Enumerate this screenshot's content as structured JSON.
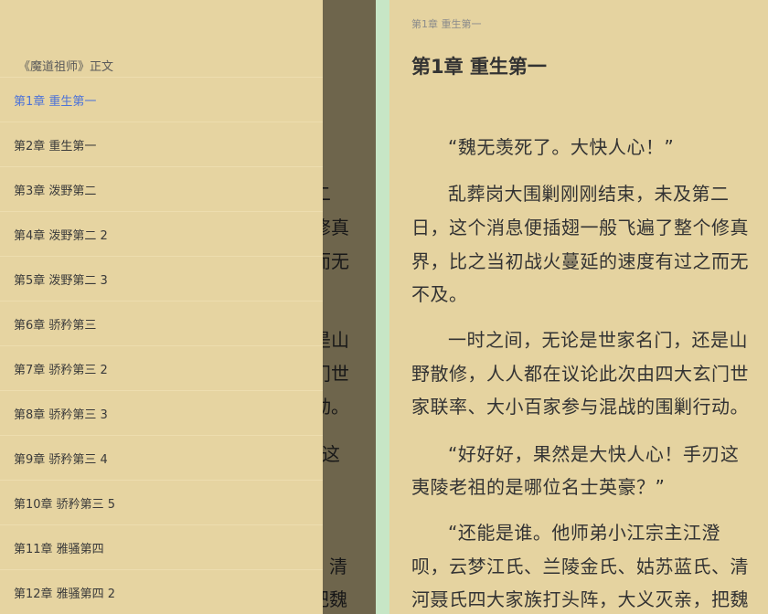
{
  "background_page": {
    "fragments": [
      "二",
      "修真",
      "而无",
      "是山",
      "门世",
      "动。",
      "这",
      "清",
      "把魏"
    ]
  },
  "toc": {
    "book_title": "《魔道祖师》正文",
    "chapters": [
      "第1章 重生第一",
      "第2章 重生第一",
      "第3章 泼野第二",
      "第4章 泼野第二 2",
      "第5章 泼野第二 3",
      "第6章 骄矜第三",
      "第7章 骄矜第三 2",
      "第8章 骄矜第三 3",
      "第9章 骄矜第三 4",
      "第10章 骄矜第三 5",
      "第11章 雅骚第四",
      "第12章 雅骚第四 2"
    ]
  },
  "reader": {
    "header": "第1章 重生第一",
    "chapter_title": "第1章 重生第一",
    "lines": [
      "“魏无羡死了。大快人心！”",
      "乱葬岗大围剿刚刚结束，未及第二",
      "日，这个消息便插翅一般飞遍了整个修真",
      "界，比之当初战火蔓延的速度有过之而无",
      "不及。",
      "一时之间，无论是世家名门，还是山",
      "野散修，人人都在议论此次由四大玄门世",
      "家联率、大小百家参与混战的围剿行动。",
      "“好好好，果然是大快人心！手刃这",
      "夷陵老祖的是哪位名士英豪？”",
      "“还能是谁。他师弟小江宗主江澄",
      "呗，云梦江氏、兰陵金氏、姑苏蓝氏、清",
      "河聂氏四大家族打头阵，大义灭亲，把魏"
    ]
  },
  "colors": {
    "paper": "#e5d3a0",
    "divider": "#c7e6c6",
    "active_chapter": "#4d73d8"
  }
}
